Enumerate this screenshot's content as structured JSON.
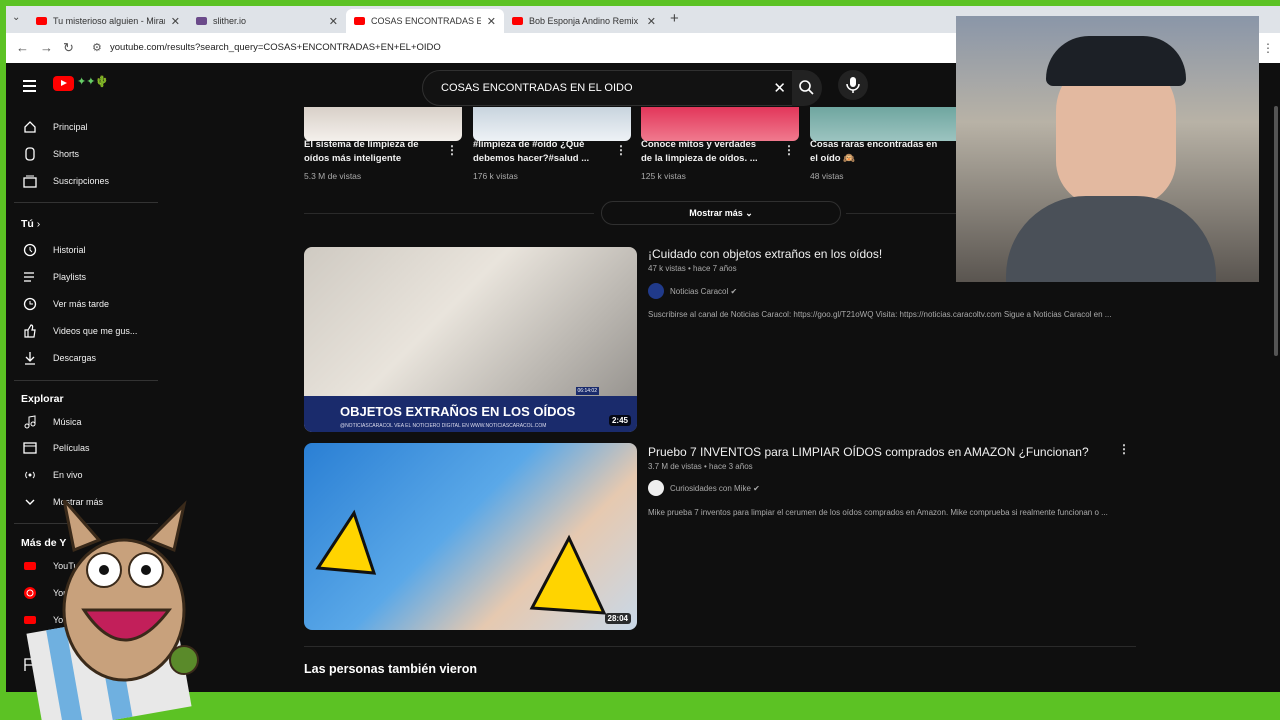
{
  "browser": {
    "tabs": [
      {
        "title": "Tu misterioso alguien - Mirand",
        "icon": "youtube-icon"
      },
      {
        "title": "slither.io",
        "icon": "slither-icon"
      },
      {
        "title": "COSAS ENCONTRADAS EN",
        "icon": "youtube-icon"
      },
      {
        "title": "Bob Esponja Andino Remix - Tik",
        "icon": "youtube-icon"
      }
    ],
    "url": "youtube.com/results?search_query=COSAS+ENCONTRADAS+EN+EL+OIDO"
  },
  "search": {
    "query": "COSAS ENCONTRADAS EN EL OIDO"
  },
  "sidebar": {
    "items": [
      {
        "label": "Principal"
      },
      {
        "label": "Shorts"
      },
      {
        "label": "Suscripciones"
      }
    ],
    "you_label": "Tú",
    "you_items": [
      {
        "label": "Historial"
      },
      {
        "label": "Playlists"
      },
      {
        "label": "Ver más tarde"
      },
      {
        "label": "Videos que me gus..."
      },
      {
        "label": "Descargas"
      }
    ],
    "explore_label": "Explorar",
    "explore_items": [
      {
        "label": "Música"
      },
      {
        "label": "Películas"
      },
      {
        "label": "En vivo"
      },
      {
        "label": "Mostrar más"
      }
    ],
    "more_label": "Más de Y",
    "more_items": [
      {
        "label": "YouTube"
      },
      {
        "label": "YouTub"
      },
      {
        "label": "YouTube K"
      }
    ]
  },
  "shelf": [
    {
      "title1": "El sistema de limpieza de",
      "title2": "oídos más inteligente",
      "views": "5.3 M de vistas"
    },
    {
      "title1": "#limpieza de #oido ¿Qué",
      "title2": "debemos hacer?#salud ...",
      "views": "176 k vistas"
    },
    {
      "title1": "Conoce mitos y verdades",
      "title2": "de la limpieza de oídos. ...",
      "views": "125 k vistas"
    },
    {
      "title1": "Cosas raras encontradas en",
      "title2": "el oído 🙉",
      "views": "48 vistas"
    }
  ],
  "show_more": "Mostrar más",
  "videos": [
    {
      "title": "¡Cuidado con objetos extraños en los oídos!",
      "meta": "47 k vistas • hace 7 años",
      "channel": "Noticias Caracol",
      "description": "Suscribirse al canal de Noticias Caracol: https://goo.gl/T21oWQ Visita: https://noticias.caracoltv.com Sigue a Noticias Caracol en ...",
      "duration": "2:45",
      "thumb_caption": "OBJETOS EXTRAÑOS EN LOS OÍDOS",
      "thumb_sub": "@NOTICIASCARACOL  VEA EL NOTICIERO DIGITAL EN WWW.NOTICIASCARACOL.COM",
      "thumb_time": "06:14:02"
    },
    {
      "title": "Pruebo 7 INVENTOS para LIMPIAR OÍDOS comprados en AMAZON ¿Funcionan?",
      "meta": "3.7 M de vistas • hace 3 años",
      "channel": "Curiosidades con Mike",
      "description": "Mike prueba 7 inventos para limpiar el cerumen de los oídos comprados en Amazon. Mike comprueba si realmente funcionan o ...",
      "duration": "28:04"
    }
  ],
  "section_title": "Las personas también vieron",
  "colors": {
    "brand": "#ff0000",
    "bg": "#0f0f0f",
    "frame": "#5cc224"
  }
}
